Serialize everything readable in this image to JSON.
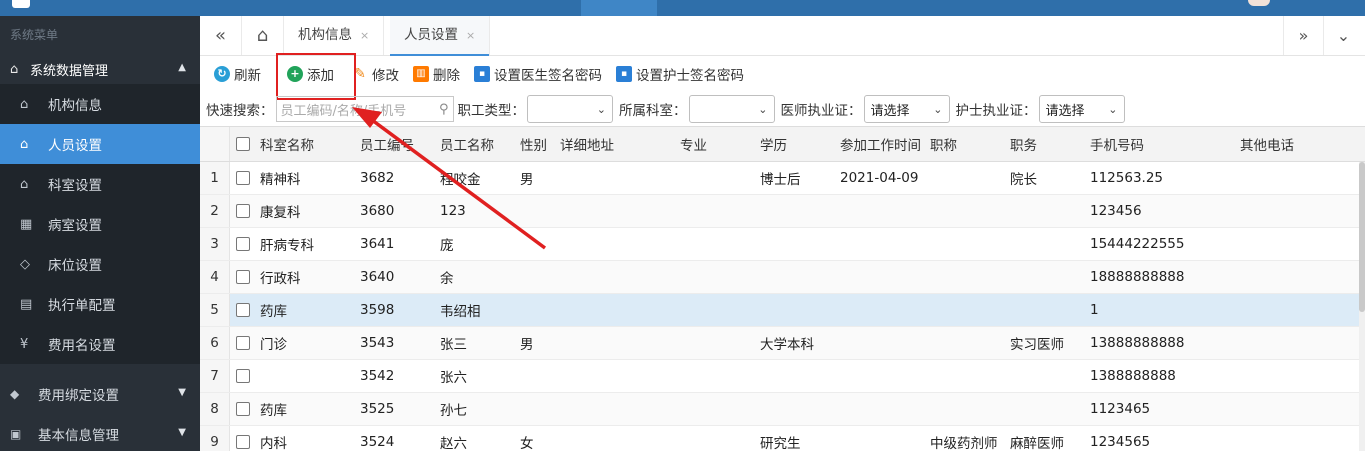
{
  "sidebar": {
    "title": "系统菜单",
    "group1": "系统数据管理",
    "items": [
      {
        "label": "机构信息",
        "icon": "home-icon"
      },
      {
        "label": "人员设置",
        "icon": "home-icon"
      },
      {
        "label": "科室设置",
        "icon": "home-icon"
      },
      {
        "label": "病室设置",
        "icon": "grid-icon"
      },
      {
        "label": "床位设置",
        "icon": "tag-icon"
      },
      {
        "label": "执行单配置",
        "icon": "list-icon"
      },
      {
        "label": "费用名设置",
        "icon": "yen-icon"
      }
    ],
    "group2": "费用绑定设置",
    "group3": "基本信息管理"
  },
  "tabs": {
    "items": [
      {
        "label": "机构信息",
        "close": "×"
      },
      {
        "label": "人员设置",
        "close": "×"
      }
    ],
    "active": "人员设置"
  },
  "toolbar": {
    "refresh": "刷新",
    "add": "添加",
    "edit": "修改",
    "delete": "删除",
    "doctor_sign": "设置医生签名密码",
    "nurse_sign": "设置护士签名密码"
  },
  "search": {
    "label": "快速搜索：",
    "placeholder": "员工编码/名称/手机号",
    "type_label": "职工类型：",
    "type_value": "",
    "dept_label": "所属科室：",
    "dept_value": "",
    "doctor_label": "医师执业证：",
    "doctor_value": "请选择",
    "nurse_label": "护士执业证：",
    "nurse_value": "请选择"
  },
  "grid": {
    "headers": [
      "科室名称",
      "员工编号",
      "员工名称",
      "性别",
      "详细地址",
      "专业",
      "学历",
      "参加工作时间",
      "职称",
      "职务",
      "手机号码",
      "其他电话"
    ],
    "rows": [
      {
        "num": "1",
        "dept": "精神科",
        "id": "3682",
        "name": "程咬金",
        "sex": "男",
        "addr": "",
        "major": "",
        "edu": "博士后",
        "date": "2021-04-09",
        "title": "",
        "post": "院长",
        "phone": "112563.25",
        "other": ""
      },
      {
        "num": "2",
        "dept": "康复科",
        "id": "3680",
        "name": "123",
        "sex": "",
        "addr": "",
        "major": "",
        "edu": "",
        "date": "",
        "title": "",
        "post": "",
        "phone": "123456",
        "other": ""
      },
      {
        "num": "3",
        "dept": "肝病专科",
        "id": "3641",
        "name": "庞",
        "sex": "",
        "addr": "",
        "major": "",
        "edu": "",
        "date": "",
        "title": "",
        "post": "",
        "phone": "15444222555",
        "other": ""
      },
      {
        "num": "4",
        "dept": "行政科",
        "id": "3640",
        "name": "余",
        "sex": "",
        "addr": "",
        "major": "",
        "edu": "",
        "date": "",
        "title": "",
        "post": "",
        "phone": "18888888888",
        "other": ""
      },
      {
        "num": "5",
        "dept": "药库",
        "id": "3598",
        "name": "韦绍相",
        "sex": "",
        "addr": "",
        "major": "",
        "edu": "",
        "date": "",
        "title": "",
        "post": "",
        "phone": "1",
        "other": ""
      },
      {
        "num": "6",
        "dept": "门诊",
        "id": "3543",
        "name": "张三",
        "sex": "男",
        "addr": "",
        "major": "",
        "edu": "大学本科",
        "date": "",
        "title": "",
        "post": "实习医师",
        "phone": "13888888888",
        "other": ""
      },
      {
        "num": "7",
        "dept": "",
        "id": "3542",
        "name": "张六",
        "sex": "",
        "addr": "",
        "major": "",
        "edu": "",
        "date": "",
        "title": "",
        "post": "",
        "phone": "1388888888",
        "other": ""
      },
      {
        "num": "8",
        "dept": "药库",
        "id": "3525",
        "name": "孙七",
        "sex": "",
        "addr": "",
        "major": "",
        "edu": "",
        "date": "",
        "title": "",
        "post": "",
        "phone": "1123465",
        "other": ""
      },
      {
        "num": "9",
        "dept": "内科",
        "id": "3524",
        "name": "赵六",
        "sex": "女",
        "addr": "",
        "major": "",
        "edu": "研究生",
        "date": "",
        "title": "中级药剂师",
        "post": "麻醉医师",
        "phone": "1234565",
        "other": ""
      }
    ],
    "selected_row": 5
  },
  "colors": {
    "accent": "#3f8ed8",
    "sidebar_bg": "#293038",
    "highlight": "#e02020"
  }
}
